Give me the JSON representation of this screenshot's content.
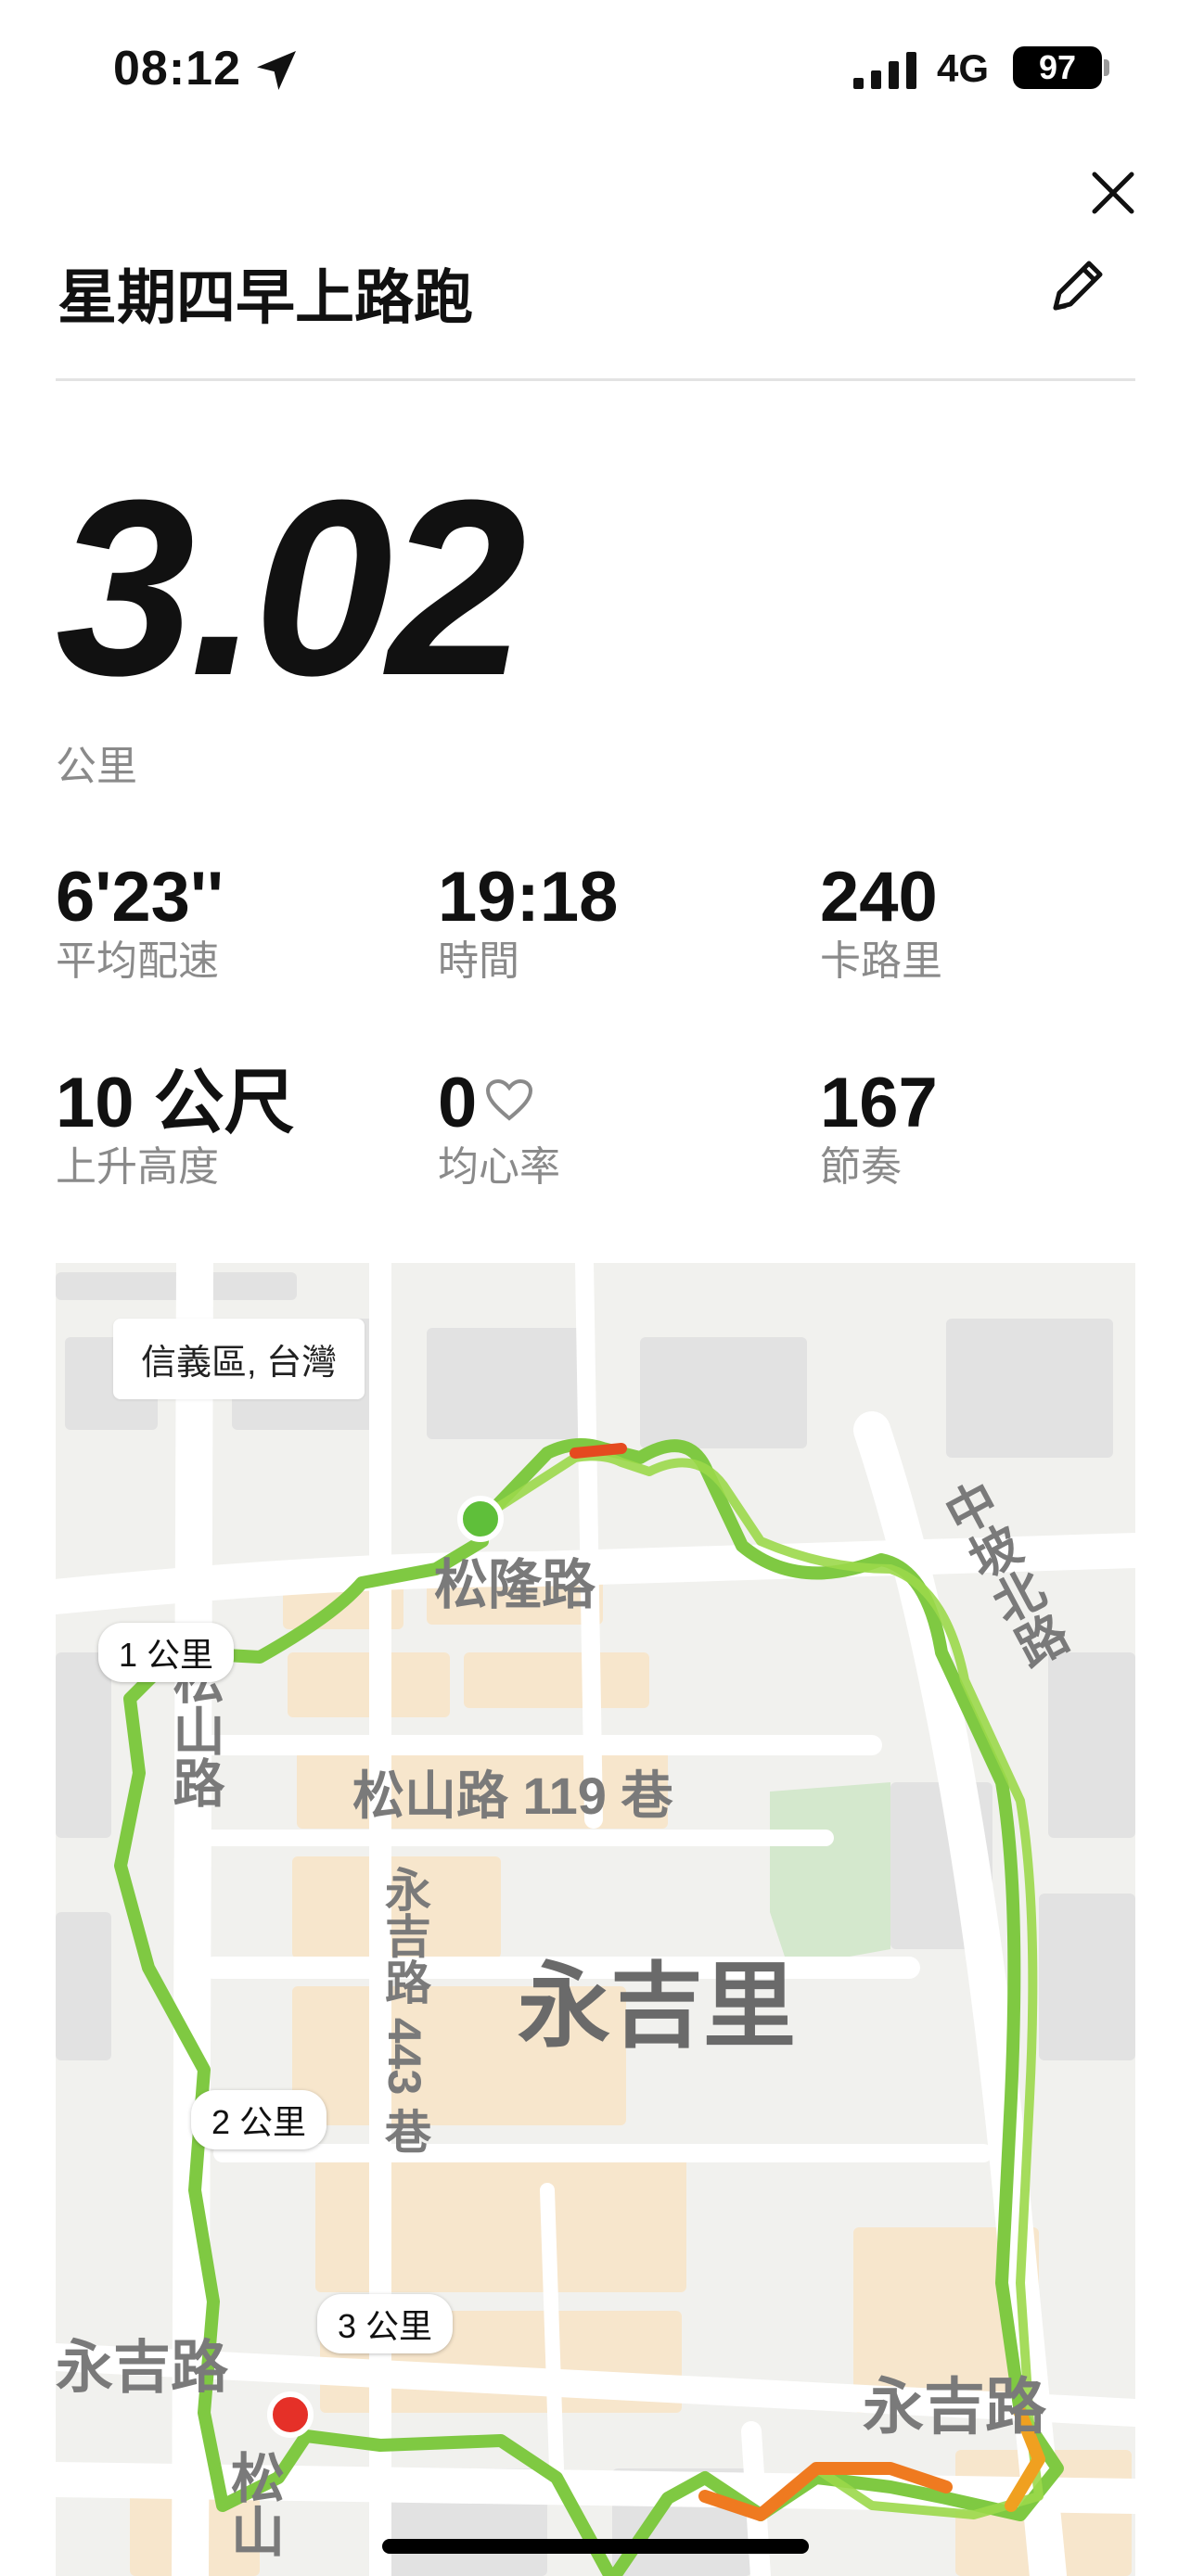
{
  "status_bar": {
    "time": "08:12",
    "network": "4G",
    "battery": "97"
  },
  "workout": {
    "title": "星期四早上路跑"
  },
  "summary": {
    "distance": "3.02",
    "distance_unit": "公里"
  },
  "stats": [
    {
      "value": "6'23''",
      "label": "平均配速"
    },
    {
      "value": "19:18",
      "label": "時間"
    },
    {
      "value": "240",
      "label": "卡路里"
    },
    {
      "value": "10 公尺",
      "label": "上升高度"
    },
    {
      "value": "0",
      "label": "均心率"
    },
    {
      "value": "167",
      "label": "節奏"
    }
  ],
  "map": {
    "region": "信義區, 台灣",
    "streets": {
      "songlong": "松隆路",
      "songshan": "松山路",
      "zhongpo": "中坡北路",
      "lane119": "松山路 119 巷",
      "lane443": "永吉路 443 巷",
      "yongji_left": "永吉路",
      "yongji_right": "永吉路",
      "songshan_bottom": "松山"
    },
    "district": "永吉里",
    "km_markers": [
      "1 公里",
      "2 公里",
      "3 公里"
    ],
    "colors": {
      "route_green": "#86cc3a",
      "route_orange": "#f07a20",
      "start": "#5fbf3a",
      "end": "#e53028"
    }
  }
}
